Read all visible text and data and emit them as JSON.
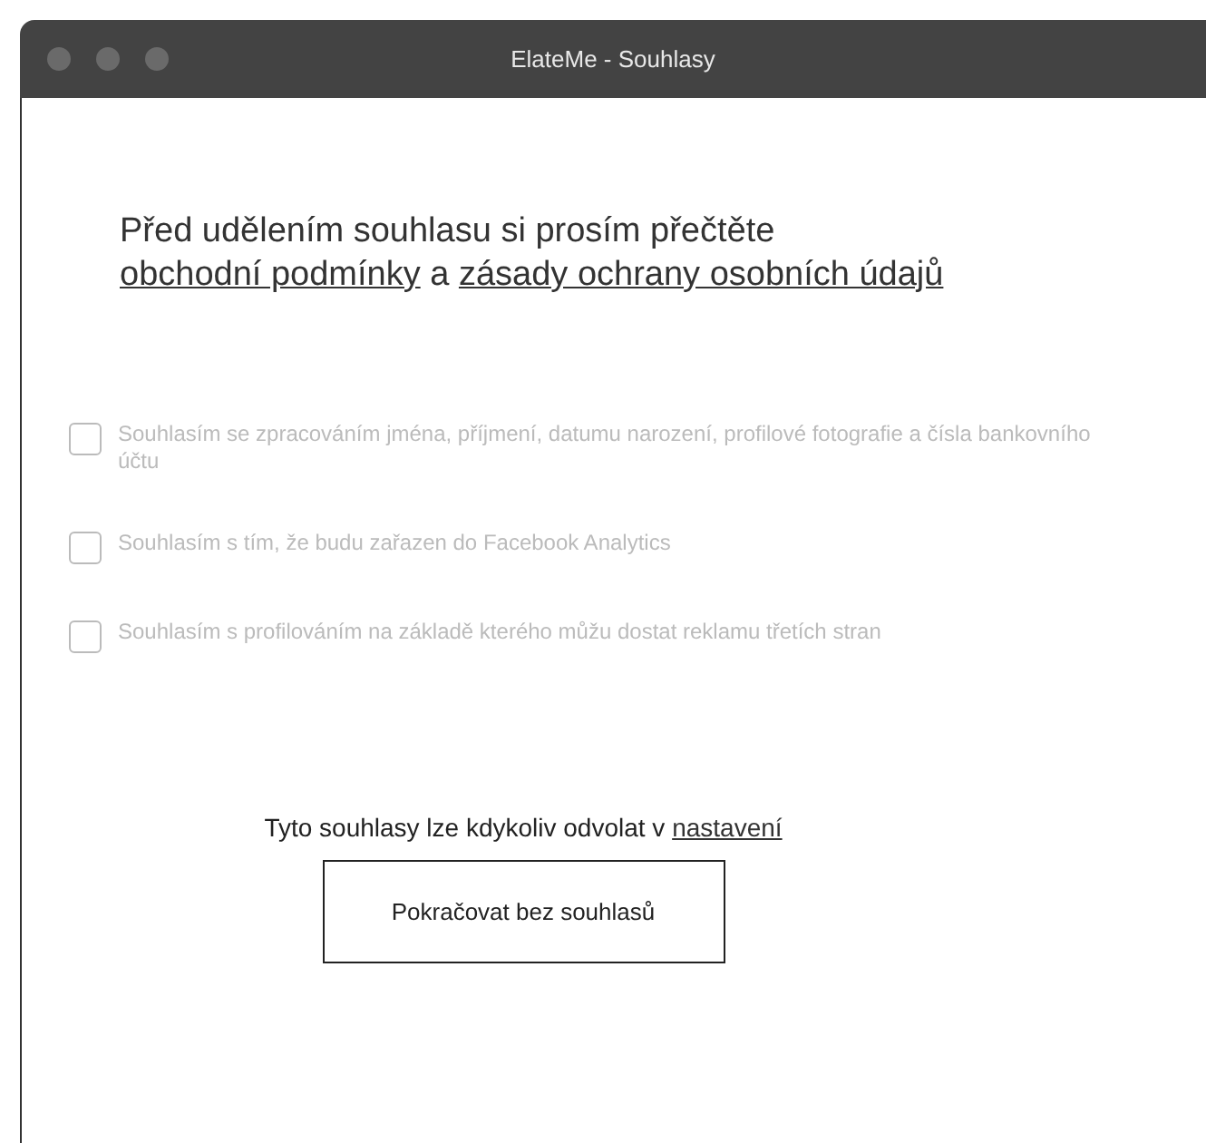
{
  "window": {
    "title": "ElateMe - Souhlasy"
  },
  "intro": [
    {
      "kind": "text",
      "text": "Před udělením souhlasu si prosím přečtěte "
    },
    {
      "kind": "link",
      "text": "obchodní podmínky"
    },
    {
      "kind": "text",
      "text": " a "
    },
    {
      "kind": "link",
      "text": "zásady ochrany osobních údajů"
    }
  ],
  "consents": [
    {
      "label": "Souhlasím se zpracováním jména, příjmení, datumu narození, profilové fotografie a čísla bankovního účtu",
      "checked": false,
      "disabled": true
    },
    {
      "label": "Souhlasím s tím, že budu zařazen do Facebook Analytics",
      "checked": false,
      "disabled": true
    },
    {
      "label": "Souhlasím s profilováním na základě kterého můžu dostat reklamu třetích stran",
      "checked": false,
      "disabled": true
    }
  ],
  "footer": {
    "text": "Tyto souhlasy lze kdykoliv odvolat v ",
    "link": "nastavení"
  },
  "button": "Pokračovat bez souhlasů"
}
